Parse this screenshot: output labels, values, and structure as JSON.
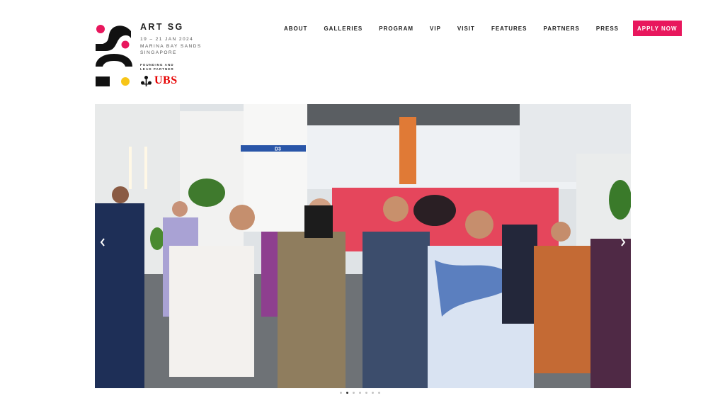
{
  "brand": {
    "name": "ART SG",
    "dates": "19 – 21 JAN 2024",
    "venue": "MARINA BAY SANDS",
    "city": "SINGAPORE",
    "partner_label_1": "FOUNDING AND",
    "partner_label_2": "LEAD PARTNER",
    "partner_name": "UBS"
  },
  "nav": {
    "items": [
      "ABOUT",
      "GALLERIES",
      "PROGRAM",
      "VIP",
      "VISIT",
      "FEATURES",
      "PARTNERS",
      "PRESS"
    ],
    "cta": "APPLY NOW"
  },
  "hero": {
    "booth_sign": "D3",
    "prev_icon": "chevron-left-icon",
    "next_icon": "chevron-right-icon",
    "slide_count": 7,
    "active_slide": 2
  },
  "colors": {
    "accent": "#e8175d",
    "ubs_red": "#e60000",
    "logo_red": "#e8175d",
    "logo_yellow": "#f7c518"
  }
}
